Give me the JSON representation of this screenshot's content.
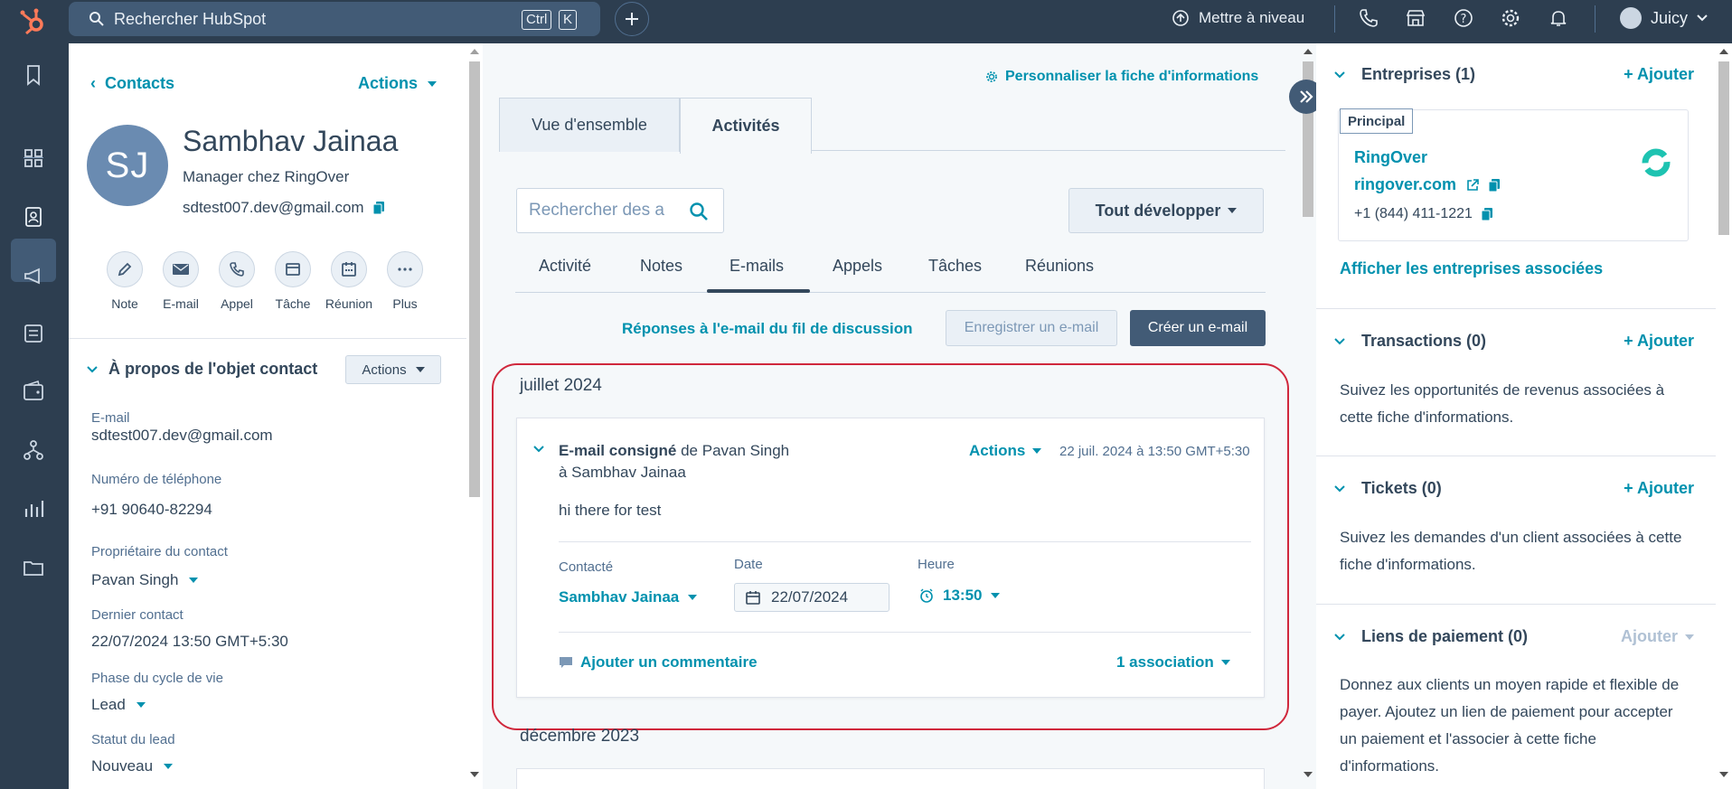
{
  "topnav": {
    "search_placeholder": "Rechercher HubSpot",
    "kbd_ctrl": "Ctrl",
    "kbd_k": "K",
    "upgrade": "Mettre à niveau",
    "account": "Juicy"
  },
  "contact": {
    "back": "Contacts",
    "actions": "Actions",
    "initials": "SJ",
    "name": "Sambhav Jainaa",
    "title": "Manager chez RingOver",
    "email": "sdtest007.dev@gmail.com",
    "quick_actions": [
      "Note",
      "E-mail",
      "Appel",
      "Tâche",
      "Réunion",
      "Plus"
    ],
    "about_title": "À propos de l'objet contact",
    "about_actions": "Actions",
    "props": [
      {
        "label": "E-mail",
        "value": "sdtest007.dev@gmail.com"
      },
      {
        "label": "Numéro de téléphone",
        "value": "+91 90640-82294"
      },
      {
        "label": "Propriétaire du contact",
        "value": "Pavan Singh"
      },
      {
        "label": "Dernier contact",
        "value": "22/07/2024 13:50 GMT+5:30"
      },
      {
        "label": "Phase du cycle de vie",
        "value": "Lead"
      },
      {
        "label": "Statut du lead",
        "value": "Nouveau"
      }
    ]
  },
  "middle": {
    "personalize": "Personnaliser la fiche d'informations",
    "tabs": [
      "Vue d'ensemble",
      "Activités"
    ],
    "search_placeholder": "Rechercher des a",
    "expand_all": "Tout développer",
    "subtabs": [
      "Activité",
      "Notes",
      "E-mails",
      "Appels",
      "Tâches",
      "Réunions"
    ],
    "thread_replies": "Réponses à l'e-mail du fil de discussion",
    "log_email": "Enregistrer un e-mail",
    "create_email": "Créer un e-mail",
    "month1": "juillet 2024",
    "email": {
      "title_bold": "E-mail consigné",
      "title_rest": " de Pavan Singh",
      "to": "à Sambhav Jainaa",
      "actions": "Actions",
      "datetime": "22 juil. 2024 à 13:50 GMT+5:30",
      "body": "hi there for test",
      "contacted_label": "Contacté",
      "contacted_value": "Sambhav Jainaa",
      "date_label": "Date",
      "date_value": "22/07/2024",
      "time_label": "Heure",
      "time_value": "13:50",
      "add_comment": "Ajouter un commentaire",
      "association": "1 association"
    },
    "month2": "décembre 2023"
  },
  "right": {
    "add": "+ Ajouter",
    "companies_title": "Entreprises (1)",
    "principal": "Principal",
    "company_name": "RingOver",
    "company_domain": "ringover.com",
    "company_phone": "+1 (844) 411-1221",
    "view_companies": "Afficher les entreprises associées",
    "deals_title": "Transactions (0)",
    "deals_text": "Suivez les opportunités de revenus associées à cette fiche d'informations.",
    "tickets_title": "Tickets (0)",
    "tickets_text": "Suivez les demandes d'un client associées à cette fiche d'informations.",
    "payments_title": "Liens de paiement (0)",
    "payments_add": "Ajouter",
    "payments_text": "Donnez aux clients un moyen rapide et flexible de payer. Ajoutez un lien de paiement pour accepter un paiement et l'associer à cette fiche d'informations."
  },
  "colors": {
    "nav": "#2d3e50",
    "link": "#0091ae",
    "brand": "#ff7a59",
    "highlight": "#d0283c"
  }
}
